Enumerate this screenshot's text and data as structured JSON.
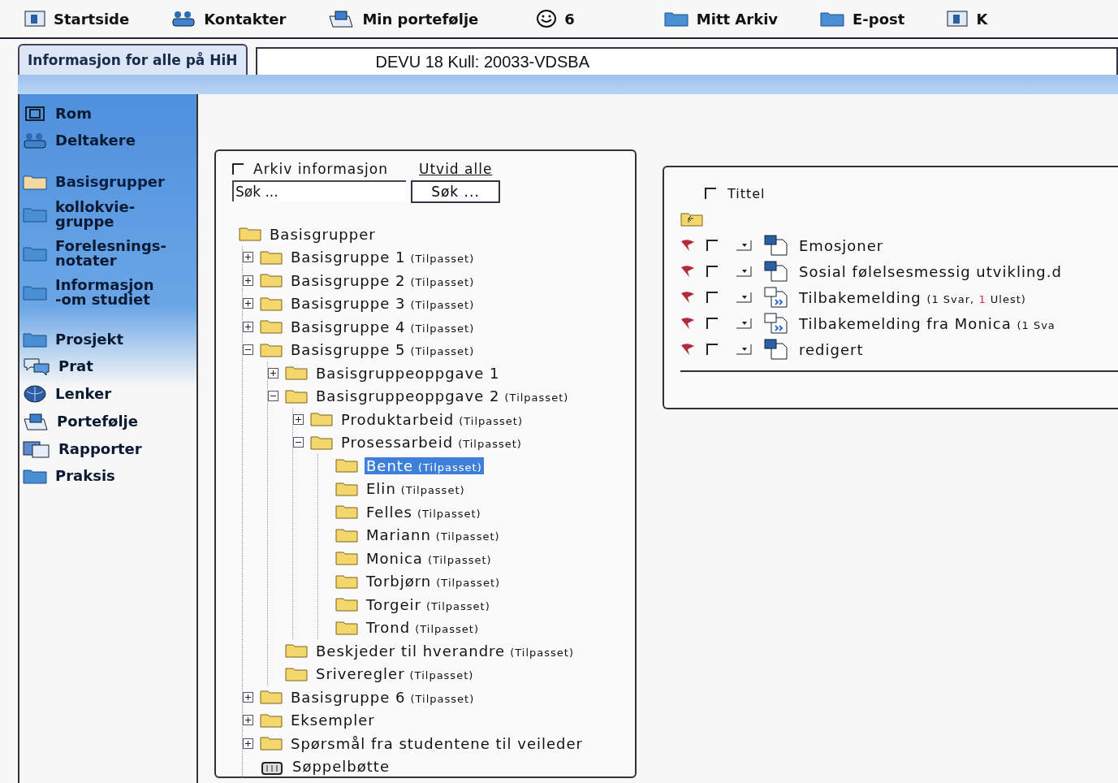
{
  "top_nav": [
    {
      "kind": "calendar",
      "label": "Startside"
    },
    {
      "kind": "people",
      "label": "Kontakter"
    },
    {
      "kind": "portfolio",
      "label": "Min portefølje"
    },
    {
      "kind": "smiley",
      "label": "6"
    },
    {
      "kind": "folder",
      "label": "Mitt Arkiv"
    },
    {
      "kind": "folder",
      "label": "E-post"
    },
    {
      "kind": "cards",
      "label": "K"
    }
  ],
  "tab": {
    "label": "Informasjon for alle på HiH"
  },
  "room_title": "DEVU 18 Kull: 20033-VDSBA",
  "sidebar": {
    "sections": [
      [
        {
          "kind": "room",
          "label": "Rom",
          "selected": false
        },
        {
          "kind": "participants",
          "label": "Deltakere",
          "selected": false
        }
      ],
      [
        {
          "kind": "folder",
          "label": "Basisgrupper",
          "selected": true
        },
        {
          "kind": "folder",
          "label": "kollokvie-\ngruppe",
          "selected": false
        },
        {
          "kind": "folder",
          "label": "Forelesnings-\nnotater",
          "selected": false
        },
        {
          "kind": "folder",
          "label": "Informasjon\n-om studiet",
          "selected": false
        }
      ],
      [
        {
          "kind": "folder",
          "label": "Prosjekt",
          "selected": false
        },
        {
          "kind": "chat",
          "label": "Prat",
          "selected": false
        },
        {
          "kind": "globe",
          "label": "Lenker",
          "selected": false
        },
        {
          "kind": "portfolio",
          "label": "Portefølje",
          "selected": false
        },
        {
          "kind": "reports",
          "label": "Rapporter",
          "selected": false
        },
        {
          "kind": "folder",
          "label": "Praksis",
          "selected": false
        }
      ]
    ]
  },
  "archive": {
    "checkbox_label": "Arkiv informasjon",
    "checked": false,
    "expand_all": "Utvid alle",
    "search": {
      "placeholder": "Søk ...",
      "button": "Søk ..."
    },
    "tree": [
      {
        "kind": "folder",
        "label": "Basisgrupper",
        "selected": false,
        "children": [
          {
            "kind": "folder",
            "label": "Basisgruppe 1",
            "note": "(Tilpasset)",
            "expanded": false,
            "selected": false
          },
          {
            "kind": "folder",
            "label": "Basisgruppe 2",
            "note": "(Tilpasset)",
            "expanded": false,
            "selected": false
          },
          {
            "kind": "folder",
            "label": "Basisgruppe 3",
            "note": "(Tilpasset)",
            "expanded": false,
            "selected": false
          },
          {
            "kind": "folder",
            "label": "Basisgruppe 4",
            "note": "(Tilpasset)",
            "expanded": false,
            "selected": false
          },
          {
            "kind": "folder",
            "label": "Basisgruppe 5",
            "note": "(Tilpasset)",
            "expanded": true,
            "selected": false,
            "children": [
              {
                "kind": "folder",
                "label": "Basisgruppeoppgave 1",
                "expanded": false,
                "selected": false
              },
              {
                "kind": "folder",
                "label": "Basisgruppeoppgave 2",
                "note": "(Tilpasset)",
                "expanded": true,
                "selected": false,
                "children": [
                  {
                    "kind": "folder",
                    "label": "Produktarbeid",
                    "note": "(Tilpasset)",
                    "expanded": false,
                    "selected": false
                  },
                  {
                    "kind": "folder",
                    "label": "Prosessarbeid",
                    "note": "(Tilpasset)",
                    "expanded": true,
                    "selected": false,
                    "children": [
                      {
                        "kind": "folder",
                        "label": "Bente",
                        "note": "(Tilpasset)",
                        "selected": true
                      },
                      {
                        "kind": "folder",
                        "label": "Elin",
                        "note": "(Tilpasset)",
                        "selected": false
                      },
                      {
                        "kind": "folder",
                        "label": "Felles",
                        "note": "(Tilpasset)",
                        "selected": false
                      },
                      {
                        "kind": "folder",
                        "label": "Mariann",
                        "note": "(Tilpasset)",
                        "selected": false
                      },
                      {
                        "kind": "folder",
                        "label": "Monica",
                        "note": "(Tilpasset)",
                        "selected": false
                      },
                      {
                        "kind": "folder",
                        "label": "Torbjørn",
                        "note": "(Tilpasset)",
                        "selected": false
                      },
                      {
                        "kind": "folder",
                        "label": "Torgeir",
                        "note": "(Tilpasset)",
                        "selected": false
                      },
                      {
                        "kind": "folder",
                        "label": "Trond",
                        "note": "(Tilpasset)",
                        "selected": false
                      }
                    ]
                  }
                ]
              },
              {
                "kind": "folder",
                "label": "Beskjeder til hverandre",
                "note": "(Tilpasset)",
                "selected": false
              },
              {
                "kind": "folder",
                "label": "Sriveregler",
                "note": "(Tilpasset)",
                "selected": false
              }
            ]
          },
          {
            "kind": "folder",
            "label": "Basisgruppe 6",
            "note": "(Tilpasset)",
            "expanded": false,
            "selected": false
          },
          {
            "kind": "folder",
            "label": "Eksempler",
            "expanded": false,
            "selected": false
          },
          {
            "kind": "folder",
            "label": "Spørsmål fra studentene til veileder",
            "expanded": false,
            "selected": false
          },
          {
            "kind": "trash",
            "label": "Søppelbøtte",
            "selected": false
          }
        ]
      }
    ]
  },
  "files": {
    "header": {
      "label": "Tittel",
      "checked": false
    },
    "rows": [
      {
        "kind": "document",
        "title": "Emosjoner",
        "checked": false,
        "note": []
      },
      {
        "kind": "document",
        "title": "Sosial følelsesmessig utvikling.d",
        "checked": false,
        "note": []
      },
      {
        "kind": "feedback",
        "title": "Tilbakemelding",
        "checked": false,
        "note": [
          {
            "text": "(1 Svar, ",
            "unread": false
          },
          {
            "text": "1",
            "unread": true
          },
          {
            "text": " Ulest)",
            "unread": false
          }
        ]
      },
      {
        "kind": "feedback",
        "title": "Tilbakemelding fra Monica",
        "checked": false,
        "note": [
          {
            "text": "(1 Sva",
            "unread": false
          }
        ]
      },
      {
        "kind": "document",
        "title": "redigert",
        "checked": false,
        "note": []
      }
    ]
  }
}
